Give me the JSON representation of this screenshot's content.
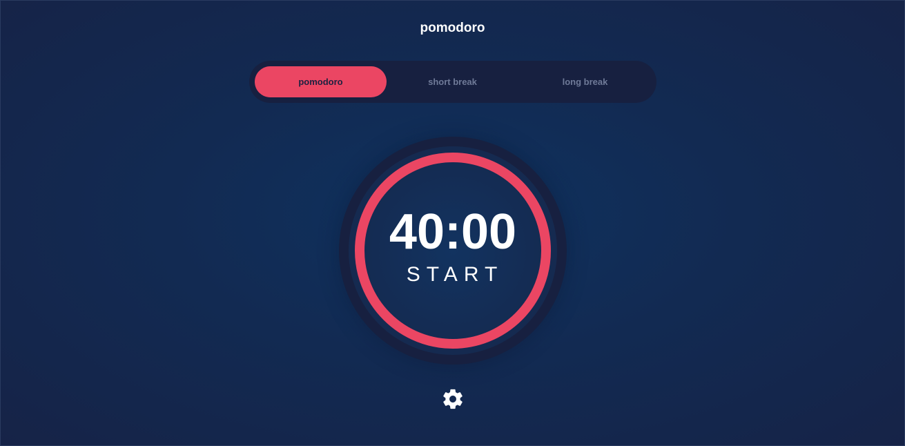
{
  "app": {
    "title": "pomodoro"
  },
  "modes": [
    {
      "label": "pomodoro",
      "active": true
    },
    {
      "label": "short break",
      "active": false
    },
    {
      "label": "long break",
      "active": false
    }
  ],
  "timer": {
    "time": "40:00",
    "action_label": "START",
    "progress": 1.0
  },
  "icons": {
    "settings": "gear-icon"
  },
  "colors": {
    "accent": "#eb4663",
    "background": "#122a52",
    "panel": "#172040",
    "text": "#ffffff",
    "muted_text": "#6f7a98"
  }
}
